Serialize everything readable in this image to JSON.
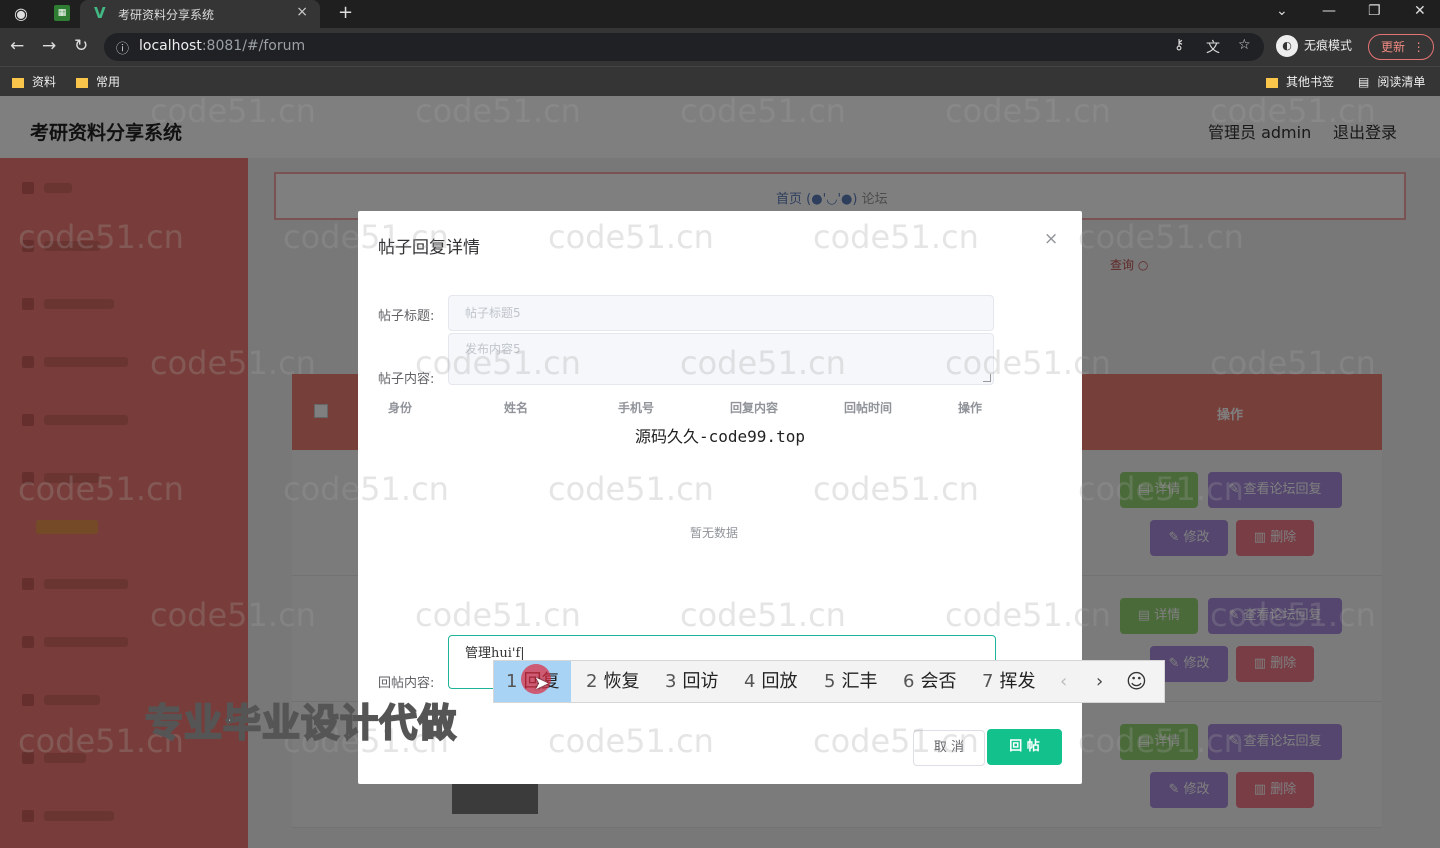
{
  "browser": {
    "tab_title": "考研资料分享系统",
    "tab_close": "×",
    "new_tab": "+",
    "url_host": "localhost",
    "url_rest": ":8081/#/forum",
    "incognito_label": "无痕模式",
    "update_label": "更新",
    "bookmarks": [
      "资料",
      "常用"
    ],
    "bookmarks_right": [
      "其他书签",
      "阅读清单"
    ]
  },
  "app": {
    "title": "考研资料分享系统",
    "user": "管理员 admin",
    "logout": "退出登录",
    "breadcrumb_home": "首页",
    "breadcrumb_sep": "(●'◡'●)",
    "breadcrumb_current": "论坛",
    "search_label": "查询",
    "table_op_header": "操作",
    "row_buttons": {
      "detail": "详情",
      "view_replies": "查看论坛回复",
      "edit": "修改",
      "delete": "删除"
    }
  },
  "dialog": {
    "title": "帖子回复详情",
    "close": "×",
    "post_title_label": "帖子标题:",
    "post_title_value": "帖子标题5",
    "post_content_label": "帖子内容:",
    "post_content_value": "发布内容5",
    "columns": [
      "身份",
      "姓名",
      "手机号",
      "回复内容",
      "回帖时间",
      "操作"
    ],
    "overlay_text": "源码久久-code99.top",
    "empty_text": "暂无数据",
    "reply_label": "回帖内容:",
    "reply_value": "管理hui'f|",
    "cancel": "取 消",
    "submit": "回 帖"
  },
  "ime": {
    "candidates": [
      {
        "n": "1",
        "text": "回复"
      },
      {
        "n": "2",
        "text": "恢复"
      },
      {
        "n": "3",
        "text": "回访"
      },
      {
        "n": "4",
        "text": "回放"
      },
      {
        "n": "5",
        "text": "汇丰"
      },
      {
        "n": "6",
        "text": "会否"
      },
      {
        "n": "7",
        "text": "挥发"
      }
    ],
    "prev": "‹",
    "next": "›",
    "emoji": "☺"
  },
  "promo_text": "专业毕业设计代做",
  "watermark": "code51.cn"
}
